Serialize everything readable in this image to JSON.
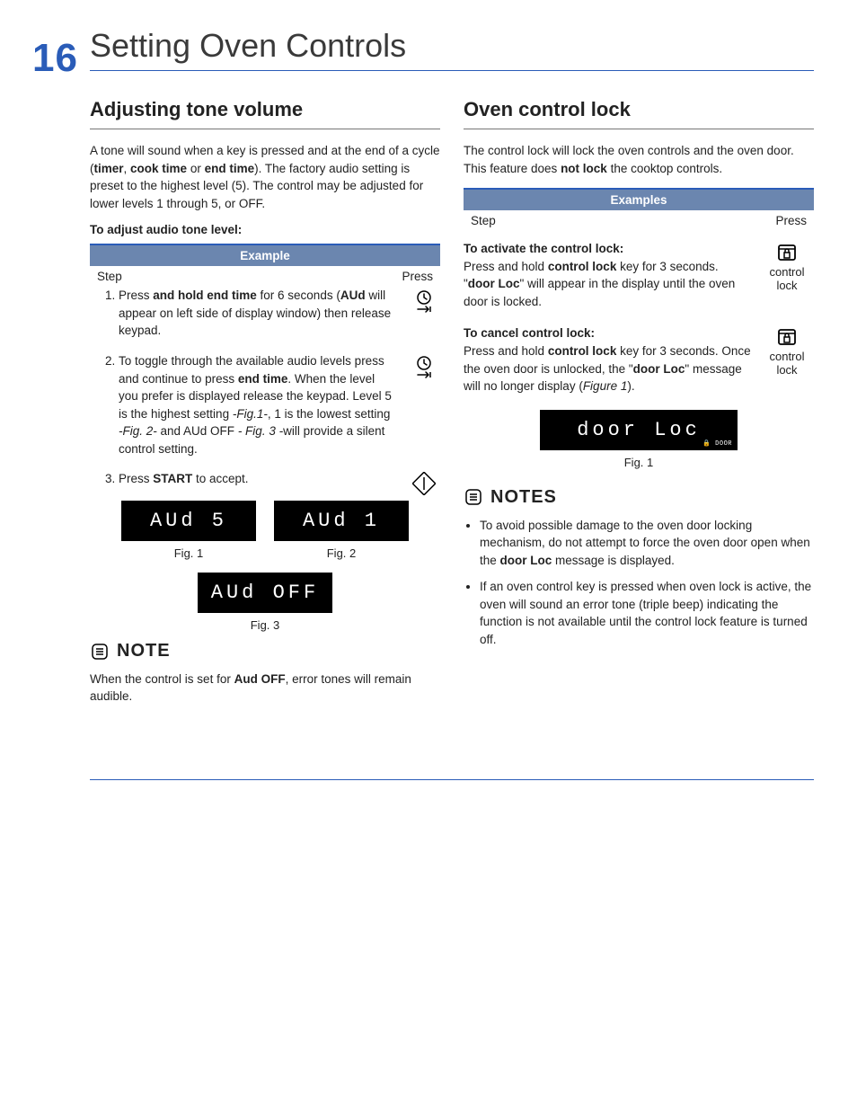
{
  "page_number": "16",
  "page_title": "Setting Oven Controls",
  "left": {
    "heading": "Adjusting tone volume",
    "intro_parts": [
      "A tone will sound when a key is pressed and at the end of a cycle (",
      "timer",
      ", ",
      "cook time",
      " or ",
      "end time",
      "). The factory audio setting is preset to the highest level (5). The control may be adjusted for lower levels 1 through 5, or OFF."
    ],
    "step_intro": "To adjust audio tone level:",
    "table_title": "Example",
    "col_step": "Step",
    "col_press": "Press",
    "steps": [
      {
        "parts": [
          "Press ",
          "and hold end time",
          " for 6 seconds (",
          "AUd",
          " will appear on left side of display window) then release keypad."
        ],
        "icon": "endtime"
      },
      {
        "parts": [
          "To toggle through the available audio levels press and continue to press ",
          "end time",
          ". When the level you prefer is displayed release the keypad. Level 5 is the highest setting ",
          "-Fig.1-",
          ", 1 is the lowest setting ",
          "-Fig. 2-",
          " and AUd OFF ",
          "- Fig. 3 -",
          "will provide a silent control setting."
        ],
        "icon": "endtime"
      },
      {
        "parts": [
          "Press ",
          "START",
          " to accept."
        ],
        "icon": "start"
      }
    ],
    "disp1": "AUd   5",
    "disp2": "AUd    1",
    "disp3": "AUd  OFF",
    "fig1": "Fig. 1",
    "fig2": "Fig. 2",
    "fig3": "Fig. 3",
    "note_title": "NOTE",
    "note_parts": [
      "When the control is set for ",
      "Aud OFF",
      ", error tones will remain audible."
    ]
  },
  "right": {
    "heading": "Oven control lock",
    "intro_parts": [
      "The control lock will lock the oven controls and the oven door. This feature does ",
      "not lock",
      " the cooktop controls."
    ],
    "table_title": "Examples",
    "col_step": "Step",
    "col_press": "Press",
    "activate_title": "To activate the control lock:",
    "activate_parts": [
      "Press and hold ",
      "control lock",
      " key for 3 seconds. \"",
      "door Loc",
      "\" will appear in the display until the oven door is locked."
    ],
    "cancel_title": "To cancel control lock:",
    "cancel_parts": [
      "Press and hold ",
      "control lock",
      " key for 3 seconds. Once the oven door is unlocked, the \"",
      "door Loc",
      "\" message will no longer display (",
      "Figure 1",
      ")."
    ],
    "icon_label": "control lock",
    "disp": "door Loc",
    "disp_tiny": "🔒 DOOR",
    "fig1": "Fig. 1",
    "notes_title": "NOTES",
    "bullets": [
      {
        "parts": [
          "To avoid possible damage to the oven door locking mechanism, do not attempt to force the oven door open when the ",
          "door Loc",
          " message is displayed."
        ]
      },
      {
        "parts": [
          "If an oven control key is pressed when oven lock is active, the oven will sound an error tone (triple beep) indicating the function is not available until the control lock feature is turned off."
        ]
      }
    ]
  }
}
